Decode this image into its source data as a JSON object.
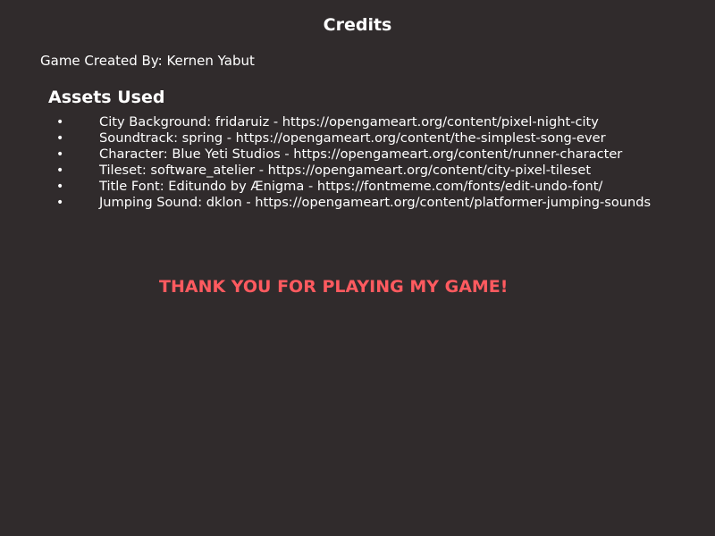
{
  "colors": {
    "background": "#302b2c",
    "text": "#ffffff",
    "accent": "#ff5a5f"
  },
  "title": "Credits",
  "creator": "Game Created By: Kernen Yabut",
  "assets_heading": "Assets Used",
  "assets": [
    "City Background: fridaruiz - https://opengameart.org/content/pixel-night-city",
    "Soundtrack: spring - https://opengameart.org/content/the-simplest-song-ever",
    "Character: Blue Yeti Studios - https://opengameart.org/content/runner-character",
    "Tileset: software_atelier - https://opengameart.org/content/city-pixel-tileset",
    "Title Font: Editundo by Ænigma - https://fontmeme.com/fonts/edit-undo-font/",
    "Jumping Sound: dklon - https://opengameart.org/content/platformer-jumping-sounds"
  ],
  "thanks": "THANK YOU FOR PLAYING MY GAME!"
}
